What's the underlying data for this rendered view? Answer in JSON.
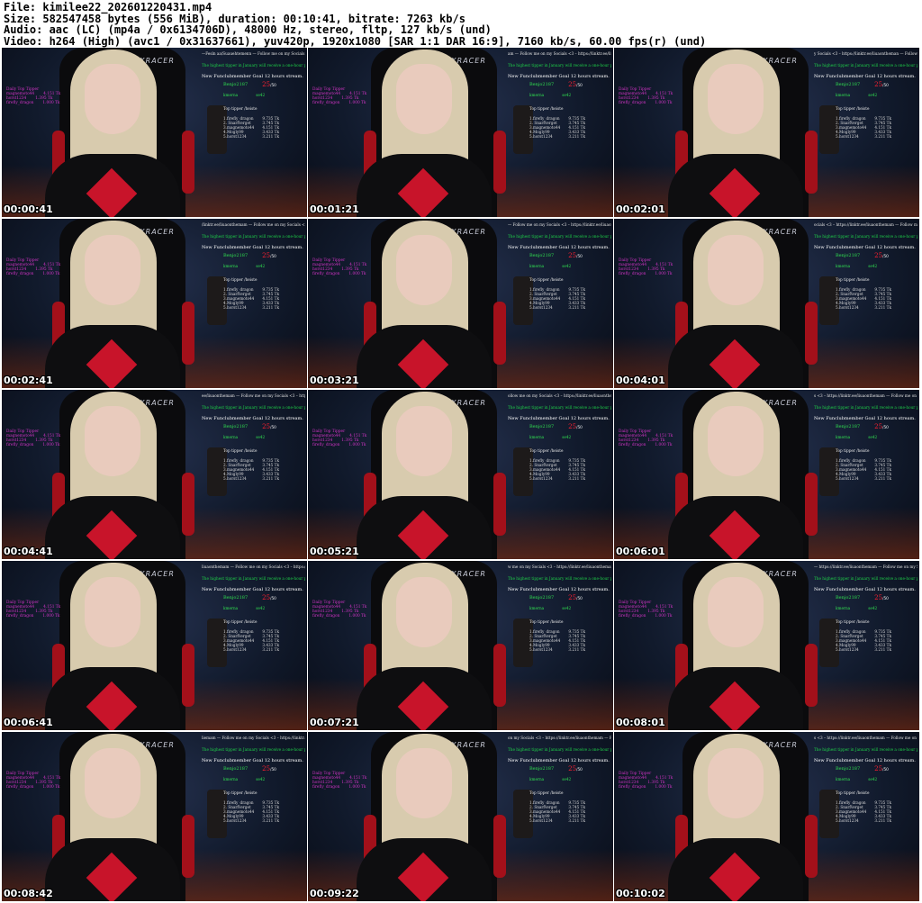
{
  "header": {
    "file": "File: kimilee22_202601220431.mp4",
    "size": "Size: 582547458 bytes (556 MiB), duration: 00:10:41, bitrate: 7263 kb/s",
    "audio": "Audio: aac (LC) (mp4a / 0x6134706D), 48000 Hz, stereo, fltp, 127 kb/s (und)",
    "video": "Video: h264 (High) (avc1 / 0x31637661), yuv420p, 1920x1080 [SAR 1:1 DAR 16:9], 7160 kb/s, 60.00 fps(r) (und)"
  },
  "colors": {
    "tip_label": "#d234c6",
    "promo": "#1ecf48",
    "goal_red": "#ff2030",
    "chair_red": "#a3101a",
    "emblem": "#c8142a"
  },
  "overlay": {
    "promo": "The highest tipper in January will receive a one-hour private show with me.",
    "goal": "New Funclubmember Goal 12 hours stream.",
    "member": "Benjo2187",
    "count": "25",
    "count_unit": "/50",
    "sub_left": "kmerna",
    "sub_right": "se42",
    "top_title": "Top tipper /heiste",
    "top_list": [
      {
        "name": "1.firefly_dragon",
        "value": "9.735 Tk"
      },
      {
        "name": "2. Snarfverget",
        "value": "3.745 Tk"
      },
      {
        "name": "3.magnemoto44",
        "value": "4.151 Tk"
      },
      {
        "name": "4.Mogly99",
        "value": "3.433 Tk"
      },
      {
        "name": "5.horst1234",
        "value": "3.211 Tk"
      }
    ],
    "left_title": "Daily Top Tipper",
    "left_list": [
      {
        "name": "magnemoto44",
        "value": "4.151 Tk"
      },
      {
        "name": "horst1234",
        "value": "1.395 Tk"
      },
      {
        "name": "firefly_dragon",
        "value": "1.000 Tk"
      }
    ]
  },
  "tiles": [
    {
      "timestamp": "00:00:41",
      "ticker": "—Fesln aa/Suauehtemenn — Follow me on my Socials <3 – http"
    },
    {
      "timestamp": "00:01:21",
      "ticker": "am — Follow me on my Socials <3 – https://linktr.ee/liuaontheman"
    },
    {
      "timestamp": "00:02:01",
      "ticker": "y Socials <3 – https://linktr.ee/liuaontheman — Follow me on my"
    },
    {
      "timestamp": "00:02:41",
      "ticker": "/linktr.ee/liuaonthemam — Follow me on my Socials <3 – https://li"
    },
    {
      "timestamp": "00:03:21",
      "ticker": "— Follow me on my Socials <3 – https://linktr.ee/liuaonthemam —"
    },
    {
      "timestamp": "00:04:01",
      "ticker": "ocials <3 – https://linktr.ee/liuaonthemam — Follow me on my Soc"
    },
    {
      "timestamp": "00:04:41",
      "ticker": "ee/liuaonthemam — Follow me on my Socials <3 – https://linktr"
    },
    {
      "timestamp": "00:05:21",
      "ticker": "ollow me on my Socials <3 – https://linktr.ee/liuaonthemam — F"
    },
    {
      "timestamp": "00:06:01",
      "ticker": "s <3 – https://linktr.ee/liuaonthemam — Follow me on my Social"
    },
    {
      "timestamp": "00:06:41",
      "ticker": "liuaonthemam — Follow me on my Socials <3 – https://linktr.ee/"
    },
    {
      "timestamp": "00:07:21",
      "ticker": "w me on my Socials <3 – https://linktr.ee/liuaonthemam — Follo"
    },
    {
      "timestamp": "00:08:01",
      "ticker": "— https://linktr.ee/liuaonthemam — Follow me on my Socials <3 –"
    },
    {
      "timestamp": "00:08:42",
      "ticker": "liemam — Follow me on my Socials <3 – https://linktr.ee/liuaont"
    },
    {
      "timestamp": "00:09:22",
      "ticker": "on my Socials <3 – https://linktr.ee/liuaonthemam — Follow me"
    },
    {
      "timestamp": "00:10:02",
      "ticker": "s <3 – https://linktr.ee/liuaonthemam — Follow me on my Socials"
    }
  ],
  "chair_logo": "DXRACER"
}
